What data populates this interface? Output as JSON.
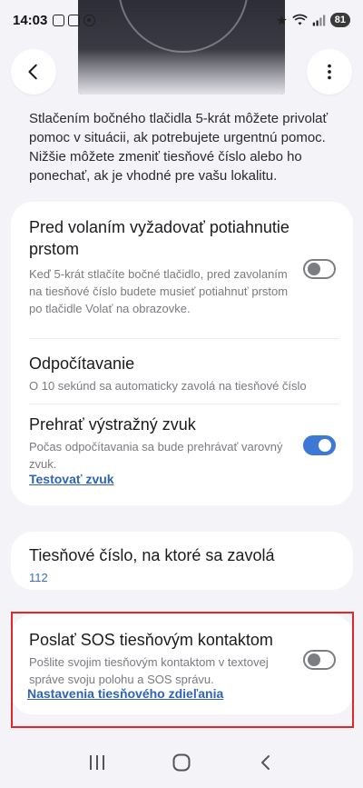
{
  "status_bar": {
    "time": "14:03",
    "battery": "81",
    "icons": [
      "screenshot-icon",
      "vpn-icon",
      "chrome-icon",
      "dot-icon",
      "star-icon",
      "wifi-icon",
      "signal-icon"
    ]
  },
  "header": {
    "back_icon": "chevron-left-icon",
    "more_icon": "more-vertical-icon"
  },
  "intro_text": "Stlačením bočného tlačidla 5-krát môžete privolať pomoc v situácii, ak potrebujete urgentnú pomoc. Nižšie môžete zmeniť tiesňové číslo alebo ho ponechať, ak je vhodné pre vašu lokalitu.",
  "settings": {
    "swipe": {
      "title": "Pred volaním vyžadovať potiahnutie prstom",
      "subtitle": "Keď 5-krát stlačíte bočné tlačidlo, pred zavolaním na tiesňové číslo budete musieť potiahnuť prstom po tlačidle Volať na obrazovke.",
      "enabled": false
    },
    "countdown": {
      "title": "Odpočítavanie",
      "subtitle": "O 10 sekúnd sa automaticky zavolá na tiesňové číslo"
    },
    "alarm": {
      "title": "Prehrať výstražný zvuk",
      "subtitle": "Počas odpočítavania sa bude prehrávať varovný zvuk.",
      "link": "Testovať zvuk",
      "enabled": true
    },
    "emergency_number": {
      "title": "Tiesňové číslo, na ktoré sa zavolá",
      "value": "112"
    },
    "sos_contacts": {
      "title": "Poslať SOS tiesňovým kontaktom",
      "subtitle": "Pošlite svojim tiesňovým kontaktom v textovej správe svoju polohu a SOS správu.",
      "link": "Nastavenia tiesňového zdieľania",
      "enabled": false
    }
  },
  "nav_bar": {
    "icons": [
      "recents-icon",
      "home-icon",
      "back-icon"
    ]
  },
  "colors": {
    "background": "#f4f3f8",
    "card": "#ffffff",
    "accent": "#3e78d6",
    "link": "#2f63b8",
    "highlight": "#e02828"
  }
}
